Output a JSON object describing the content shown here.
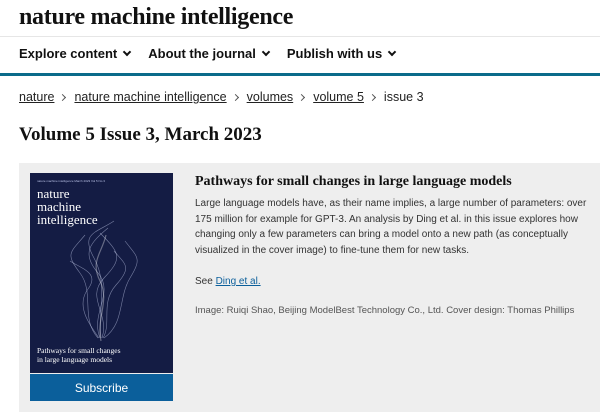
{
  "site": {
    "masthead": "nature machine intelligence"
  },
  "nav": [
    {
      "label": "Explore content"
    },
    {
      "label": "About the journal"
    },
    {
      "label": "Publish with us"
    }
  ],
  "breadcrumb": {
    "items": [
      "nature",
      "nature machine intelligence",
      "volumes",
      "volume 5"
    ],
    "current": "issue 3"
  },
  "issue": {
    "title": "Volume 5 Issue 3, March 2023"
  },
  "cover": {
    "top_text": "nature machine intelligence March 2023 Vol 5 No 3",
    "masthead": "nature\nmachine\nintelligence",
    "caption": "Pathways for small changes\nin large language models"
  },
  "subscribe_label": "Subscribe",
  "article": {
    "title": "Pathways for small changes in large language models",
    "description": "Large language models have, as their name implies, a large number of parameters: over 175 million for example for GPT-3. An analysis by Ding et al. in this issue explores how changing only a few parameters can bring a model onto a new path (as conceptually visualized in the cover image) to fine-tune them for new tasks.",
    "see_prefix": "See ",
    "see_link": "Ding et al.",
    "credit": "Image: Ruiqi Shao, Beijing ModelBest Technology Co., Ltd. Cover design: Thomas Phillips"
  },
  "colors": {
    "accent_line": "#0a6b8a",
    "subscribe_bg": "#0b5f9b",
    "cover_bg": "#141c44",
    "panel_bg": "#eeeeee"
  }
}
